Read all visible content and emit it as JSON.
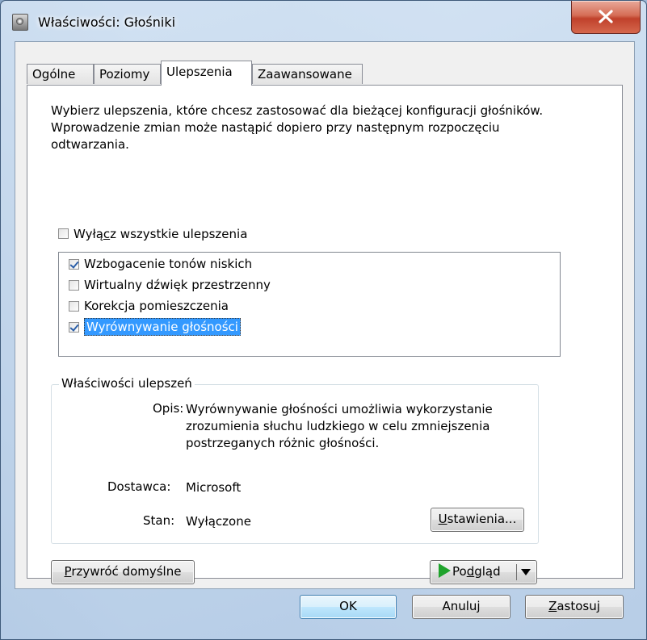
{
  "window": {
    "title": "Właściwości: Głośniki"
  },
  "tabs": [
    {
      "label": "Ogólne"
    },
    {
      "label": "Poziomy"
    },
    {
      "label": "Ulepszenia"
    },
    {
      "label": "Zaawansowane"
    }
  ],
  "active_tab": "Ulepszenia",
  "enhancements": {
    "description": "Wybierz ulepszenia, które chcesz zastosować dla bieżącej konfiguracji głośników. Wprowadzenie zmian może nastąpić dopiero przy następnym rozpoczęciu odtwarzania.",
    "disable_all": {
      "pre": "Wyłą",
      "accel": "c",
      "post": "z wszystkie ulepszenia",
      "checked": false
    },
    "items": [
      {
        "label": "Wzbogacenie tonów niskich",
        "checked": true,
        "selected": false
      },
      {
        "label": "Wirtualny dźwięk przestrzenny",
        "checked": false,
        "selected": false
      },
      {
        "label": "Korekcja pomieszczenia",
        "checked": false,
        "selected": false
      },
      {
        "label": "Wyrównywanie głośności",
        "checked": true,
        "selected": true
      }
    ]
  },
  "properties": {
    "group_title": "Właściwości ulepszeń",
    "description_label": "Opis:",
    "description_lines": [
      "Wyrównywanie głośności umożliwia wykorzystanie",
      "zrozumienia słuchu ludzkiego w celu zmniejszenia",
      "postrzeganych różnic głośności."
    ],
    "provider_label": "Dostawca:",
    "provider_value": "Microsoft",
    "state_label": "Stan:",
    "state_value": "Wyłączone",
    "settings_button": {
      "accel": "U",
      "rest": "stawienia..."
    }
  },
  "restore_button": {
    "accel": "P",
    "rest": "rzywróć domyślne"
  },
  "preview_button": {
    "pre": "Po",
    "accel": "d",
    "post": "gląd"
  },
  "buttons": {
    "ok": "OK",
    "cancel": "Anuluj",
    "apply": {
      "accel": "Z",
      "rest": "astosuj"
    }
  },
  "colors": {
    "selection": "#3399ff",
    "play_icon": "#1fa32c",
    "close_button": "#c0412b"
  }
}
